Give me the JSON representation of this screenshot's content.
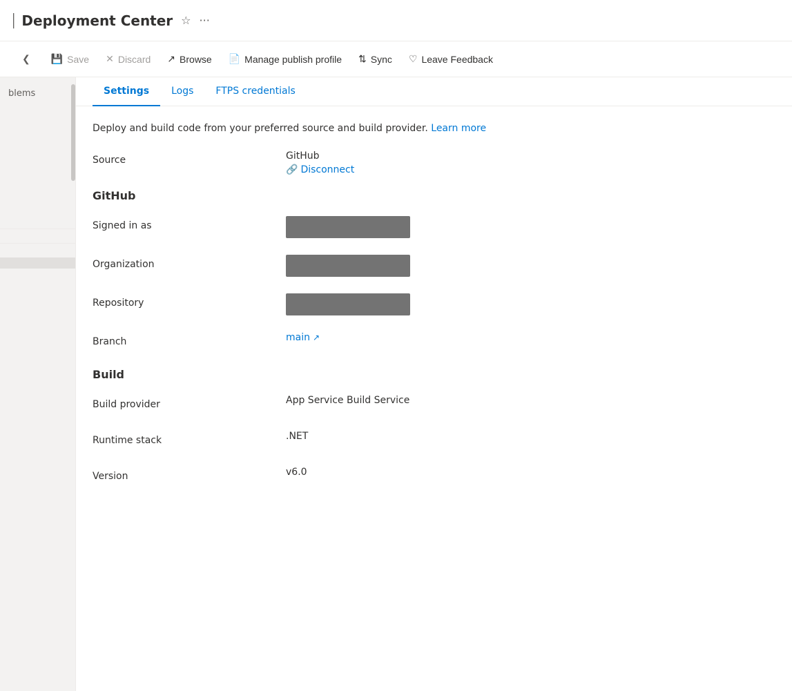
{
  "header": {
    "pipe": "|",
    "title": "Deployment Center",
    "star_icon": "☆",
    "more_icon": "···"
  },
  "toolbar": {
    "save_label": "Save",
    "discard_label": "Discard",
    "browse_label": "Browse",
    "manage_publish_label": "Manage publish profile",
    "sync_label": "Sync",
    "leave_feedback_label": "Leave Feedback"
  },
  "sidebar": {
    "problems_label": "blems",
    "collapse_icon": "❮"
  },
  "tabs": [
    {
      "id": "settings",
      "label": "Settings",
      "active": true
    },
    {
      "id": "logs",
      "label": "Logs",
      "active": false
    },
    {
      "id": "ftps",
      "label": "FTPS credentials",
      "active": false
    }
  ],
  "description": {
    "text": "Deploy and build code from your preferred source and build provider.",
    "learn_more_label": "Learn more"
  },
  "source_section": {
    "label": "Source",
    "value": "GitHub",
    "disconnect_label": "Disconnect"
  },
  "github_section": {
    "title": "GitHub",
    "signed_in_as_label": "Signed in as",
    "organization_label": "Organization",
    "repository_label": "Repository",
    "branch_label": "Branch",
    "branch_value": "main",
    "external_icon": "⊞"
  },
  "build_section": {
    "title": "Build",
    "build_provider_label": "Build provider",
    "build_provider_value": "App Service Build Service",
    "runtime_stack_label": "Runtime stack",
    "runtime_stack_value": ".NET",
    "version_label": "Version",
    "version_value": "v6.0"
  }
}
